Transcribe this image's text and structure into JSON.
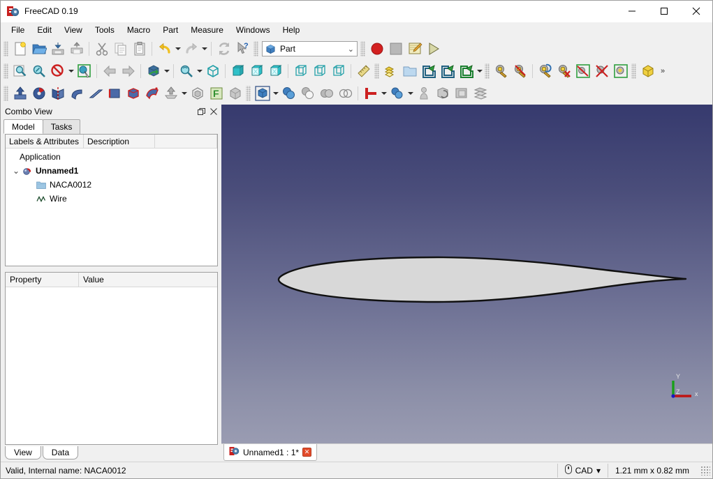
{
  "window": {
    "title": "FreeCAD 0.19",
    "app_icon": "freecad-logo-icon",
    "minimize_label": "–",
    "maximize_label": "□",
    "close_label": "✕"
  },
  "menubar": {
    "items": [
      {
        "label": "File"
      },
      {
        "label": "Edit"
      },
      {
        "label": "View"
      },
      {
        "label": "Tools"
      },
      {
        "label": "Macro"
      },
      {
        "label": "Part"
      },
      {
        "label": "Measure"
      },
      {
        "label": "Windows"
      },
      {
        "label": "Help"
      }
    ]
  },
  "toolbars": {
    "file": [
      {
        "name": "new-document-icon",
        "title": "New"
      },
      {
        "name": "open-document-icon",
        "title": "Open"
      },
      {
        "name": "save-document-icon",
        "title": "Save"
      },
      {
        "name": "print-document-icon",
        "title": "Print"
      },
      {
        "name": "cut-icon",
        "title": "Cut"
      },
      {
        "name": "copy-icon",
        "title": "Copy"
      },
      {
        "name": "paste-icon",
        "title": "Paste"
      },
      {
        "name": "undo-icon",
        "title": "Undo"
      },
      {
        "name": "redo-icon",
        "title": "Redo"
      },
      {
        "name": "refresh-icon",
        "title": "Refresh"
      },
      {
        "name": "whats-this-icon",
        "title": "What's This?"
      }
    ],
    "workbench": {
      "selected": "Part",
      "icon": "workbench-part-icon"
    },
    "macro": [
      {
        "name": "macro-record-icon",
        "title": "Macro recording"
      },
      {
        "name": "macro-stop-icon",
        "title": "Stop macro recording"
      },
      {
        "name": "macro-edit-icon",
        "title": "Macros"
      },
      {
        "name": "macro-execute-icon",
        "title": "Execute macro"
      }
    ],
    "view_row": [
      {
        "name": "fit-all-icon",
        "title": "Fit all"
      },
      {
        "name": "fit-selection-icon",
        "title": "Fit selection"
      },
      {
        "name": "draw-style-icon",
        "title": "Draw style"
      },
      {
        "name": "selection-view-icon",
        "title": "Selection view"
      },
      {
        "name": "nav-back-icon",
        "title": "Back"
      },
      {
        "name": "nav-forward-icon",
        "title": "Forward"
      },
      {
        "name": "std-views-icon",
        "title": "Standard views"
      },
      {
        "name": "axonometric-icon",
        "title": "Axonometric"
      },
      {
        "name": "front-view-icon",
        "title": "Front"
      },
      {
        "name": "top-view-icon",
        "title": "Top"
      },
      {
        "name": "right-view-icon",
        "title": "Right"
      },
      {
        "name": "rear-view-icon",
        "title": "Rear"
      },
      {
        "name": "bottom-view-icon",
        "title": "Bottom"
      },
      {
        "name": "left-view-icon",
        "title": "Left"
      },
      {
        "name": "measure-ruler-icon",
        "title": "Measure"
      },
      {
        "name": "create-group-icon",
        "title": "Create group"
      },
      {
        "name": "folder-icon",
        "title": "Group"
      },
      {
        "name": "link-make-icon",
        "title": "Make link"
      },
      {
        "name": "link-group-icon",
        "title": "Make link group"
      },
      {
        "name": "link-actions-icon",
        "title": "Link actions"
      },
      {
        "name": "clipping-plane-icon",
        "title": "Clipping plane"
      },
      {
        "name": "texture-mapping-icon",
        "title": "Texture mapping"
      },
      {
        "name": "scene-inspector-icon",
        "title": "Scene inspector"
      },
      {
        "name": "remove-objects-icon",
        "title": "Remove objects"
      },
      {
        "name": "bounding-box-icon",
        "title": "Bounding box"
      },
      {
        "name": "delete-bbox-icon",
        "title": "Delete bounding box"
      },
      {
        "name": "geometry-check-icon",
        "title": "Check geometry"
      },
      {
        "name": "box-solid-icon",
        "title": "Box"
      }
    ],
    "part_row": [
      {
        "name": "extrude-icon",
        "title": "Extrude"
      },
      {
        "name": "revolve-icon",
        "title": "Revolve"
      },
      {
        "name": "mirror-icon",
        "title": "Mirroring"
      },
      {
        "name": "fillet-icon",
        "title": "Fillet"
      },
      {
        "name": "chamfer-icon",
        "title": "Chamfer"
      },
      {
        "name": "ruled-surface-icon",
        "title": "Ruled surface"
      },
      {
        "name": "loft-icon",
        "title": "Loft"
      },
      {
        "name": "sweep-icon",
        "title": "Sweep"
      },
      {
        "name": "section-icon",
        "title": "Section"
      },
      {
        "name": "offset-3d-icon",
        "title": "3D offset"
      },
      {
        "name": "thickness-icon",
        "title": "Thickness"
      },
      {
        "name": "projection-shape-icon",
        "title": "Shape from mesh"
      },
      {
        "name": "box-gray-icon",
        "title": "Box"
      },
      {
        "name": "primitives-icon",
        "title": "Primitives"
      },
      {
        "name": "boolean-icon",
        "title": "Boolean"
      },
      {
        "name": "cut-boolean-icon",
        "title": "Cut"
      },
      {
        "name": "union-icon",
        "title": "Union"
      },
      {
        "name": "intersection-icon",
        "title": "Intersection"
      },
      {
        "name": "join-connect-icon",
        "title": "Join objects"
      },
      {
        "name": "split-objects-icon",
        "title": "Split objects"
      },
      {
        "name": "compound-tools-icon",
        "title": "Compound tools"
      },
      {
        "name": "boolean-fragments-icon",
        "title": "Boolean fragments"
      },
      {
        "name": "slice-apart-icon",
        "title": "Slice apart"
      },
      {
        "name": "cross-sections-icon",
        "title": "Cross-sections"
      }
    ]
  },
  "combo_view": {
    "title": "Combo View",
    "float_label": "❐",
    "close_label": "✕",
    "tabs": [
      {
        "label": "Model",
        "active": true
      },
      {
        "label": "Tasks",
        "active": false
      }
    ],
    "tree": {
      "columns": [
        "Labels & Attributes",
        "Description"
      ],
      "rows": [
        {
          "label": "Application",
          "icon": "none",
          "depth": 0,
          "bold": false,
          "twisty": ""
        },
        {
          "label": "Unnamed1",
          "icon": "document-icon",
          "depth": 0,
          "bold": true,
          "twisty": "⌄"
        },
        {
          "label": "NACA0012",
          "icon": "folder-icon",
          "depth": 1,
          "bold": false,
          "twisty": ""
        },
        {
          "label": "Wire",
          "icon": "wire-icon",
          "depth": 1,
          "bold": false,
          "twisty": ""
        }
      ]
    },
    "properties": {
      "columns": [
        "Property",
        "Value"
      ],
      "rows": []
    },
    "bottom_tabs": [
      {
        "label": "View"
      },
      {
        "label": "Data"
      }
    ]
  },
  "viewport": {
    "background_top": "#363a6e",
    "background_bottom": "#9a9cb2",
    "shape_fill": "#d8d8d8",
    "shape_stroke": "#101010",
    "shape_name": "naca0012-airfoil",
    "axis": {
      "x_label": "x",
      "y_label": "Y",
      "z_label": "Z",
      "x_color": "#c01010",
      "y_color": "#10a010",
      "z_color": "#1010c0"
    },
    "tabs": [
      {
        "label": "Unnamed1 : 1*",
        "close": "✕",
        "icon": "freecad-logo-icon"
      }
    ]
  },
  "statusbar": {
    "message": "Valid, Internal name: NACA0012",
    "nav_style": "CAD",
    "nav_icon": "mouse-icon",
    "nav_chevron": "▾",
    "dimensions": "1.21 mm x 0.82 mm"
  }
}
